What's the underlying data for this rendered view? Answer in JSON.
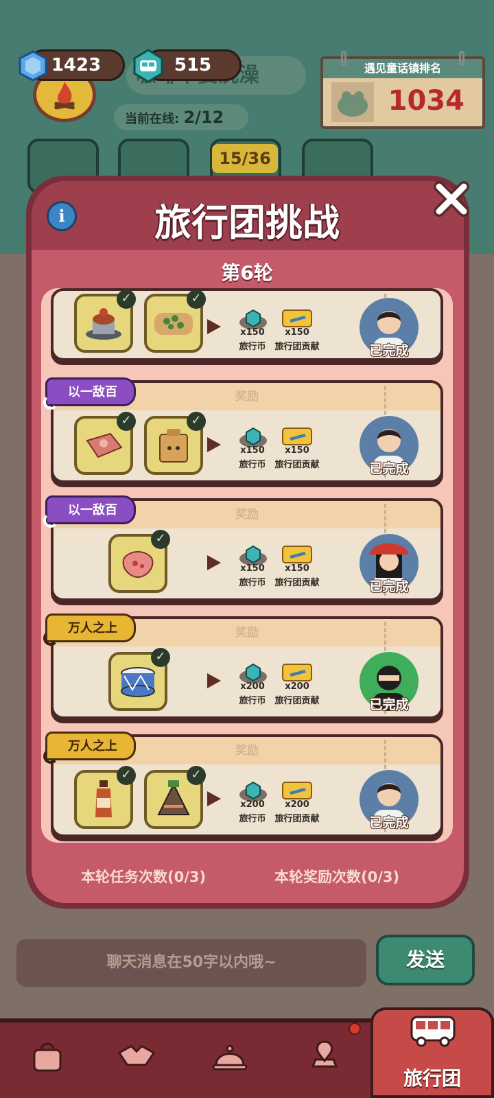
{
  "header": {
    "diamonds": "1423",
    "coins": "515",
    "group_title": "咖啡不要洗澡",
    "online_label": "当前在线:",
    "online_count": "2/12",
    "rank_label": "遇见童话镇排名",
    "rank_value": "1034",
    "progress_badge": "15/36"
  },
  "dialog": {
    "title": "旅行团挑战",
    "round": "第6轮",
    "info_icon": "info-icon",
    "close_icon": "close-icon"
  },
  "cards": [
    {
      "tag": "",
      "reward_header": "",
      "items": [
        "pudding-icon",
        "toast-icon"
      ],
      "coin_amount": "x150",
      "coin_label": "旅行币",
      "contrib_amount": "x150",
      "contrib_label": "旅行团贡献",
      "status": "已完成"
    },
    {
      "tag": "以一敌百",
      "tag_color": "#8a4ec2",
      "reward_header": "奖励",
      "items": [
        "meat-icon",
        "bag-icon"
      ],
      "coin_amount": "x150",
      "coin_label": "旅行币",
      "contrib_amount": "x150",
      "contrib_label": "旅行团贡献",
      "status": "已完成"
    },
    {
      "tag": "以一敌百",
      "tag_color": "#8a4ec2",
      "reward_header": "奖励",
      "items": [
        "candy-icon"
      ],
      "coin_amount": "x150",
      "coin_label": "旅行币",
      "contrib_amount": "x150",
      "contrib_label": "旅行团贡献",
      "status": "已完成"
    },
    {
      "tag": "万人之上",
      "tag_color": "#e8b634",
      "reward_header": "奖励",
      "items": [
        "drum-icon"
      ],
      "coin_amount": "x200",
      "coin_label": "旅行币",
      "contrib_amount": "x200",
      "contrib_label": "旅行团贡献",
      "status": "已完成"
    },
    {
      "tag": "万人之上",
      "tag_color": "#e8b634",
      "reward_header": "奖励",
      "items": [
        "sauce-bottle-icon",
        "onigiri-icon"
      ],
      "coin_amount": "x200",
      "coin_label": "旅行币",
      "contrib_amount": "x200",
      "contrib_label": "旅行团贡献",
      "status": "已完成"
    }
  ],
  "footer": {
    "task_count": "本轮任务次数(0/3)",
    "reward_count": "本轮奖励次数(0/3)"
  },
  "chat": {
    "placeholder": "聊天消息在50字以内哦~",
    "send_label": "发送"
  },
  "tabbar": {
    "active_label": "旅行团",
    "tabs": [
      "shop-bag-icon",
      "handshake-icon",
      "cloche-icon",
      "map-icon",
      "bus-icon"
    ]
  },
  "colors": {
    "panel": "#c45a6a",
    "accent_green": "#3d8a73",
    "tag_purple": "#8a4ec2",
    "tag_gold": "#e8b634"
  }
}
